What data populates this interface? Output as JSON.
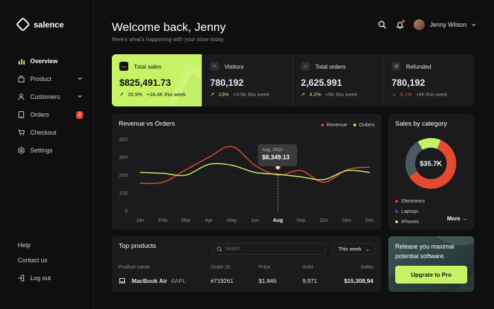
{
  "brand": {
    "name": "salence"
  },
  "nav": {
    "items": [
      {
        "label": "Overview",
        "icon": "bar-chart-icon"
      },
      {
        "label": "Product",
        "icon": "bag-icon"
      },
      {
        "label": "Customers",
        "icon": "user-icon"
      },
      {
        "label": "Orders",
        "icon": "tablet-icon",
        "badge": "2"
      },
      {
        "label": "Checkout",
        "icon": "cart-icon"
      },
      {
        "label": "Settings",
        "icon": "gear-icon"
      }
    ],
    "bottom": [
      {
        "label": "Help"
      },
      {
        "label": "Contact us"
      },
      {
        "label": "Log out",
        "icon": "logout-icon"
      }
    ]
  },
  "header": {
    "title": "Welcome back, Jenny",
    "subtitle": "Here's what's happening with your store today.",
    "user": "Jenny Wilson"
  },
  "stats": [
    {
      "label": "Total sales",
      "value": "$825,491.73",
      "pct": "20.9%",
      "note": "+18.4K this week",
      "dir": "up",
      "icon": "wallet-icon"
    },
    {
      "label": "Visitors",
      "value": "780,192",
      "pct": "13%",
      "note": "+3.5K this week",
      "dir": "up",
      "icon": "users-icon"
    },
    {
      "label": "Total orders",
      "value": "2,625.991",
      "pct": "4.2%",
      "note": "+5K this week",
      "dir": "up",
      "icon": "star-icon"
    },
    {
      "label": "Refunded",
      "value": "780,192",
      "pct": "9.1%",
      "note": "+66 this week",
      "dir": "down",
      "icon": "refund-icon"
    }
  ],
  "revenue": {
    "title": "Revenue vs Orders",
    "legend": {
      "revenue": "Revenue",
      "orders": "Orders"
    },
    "tooltip": {
      "date": "Aug, 2022",
      "value": "$8,349.13"
    }
  },
  "category": {
    "title": "Sales by category",
    "total": "$35.7K",
    "items": [
      "Electronics",
      "Laptops",
      "iPhones"
    ],
    "more": "More"
  },
  "products": {
    "title": "Top products",
    "search_placeholder": "Search",
    "period": "This week",
    "columns": [
      "Product name",
      "Order ID",
      "Price",
      "Sold",
      "Sales"
    ],
    "rows": [
      {
        "name": "MacBook Air",
        "ticker": "AAPL",
        "order_id": "#719261",
        "price": "$1,846",
        "sold": "9,971",
        "sales": "$15,308,94"
      }
    ]
  },
  "upgrade": {
    "text": "Release you maximal potential software.",
    "button": "Upgrate to Pro"
  },
  "colors": {
    "accent": "#c6f266",
    "revenue": "#e24b2f",
    "orders": "#c6f266",
    "laptops": "#4b5a5e"
  },
  "chart_data": [
    {
      "type": "line",
      "title": "Revenue vs Orders",
      "categories": [
        "Jan",
        "Feb",
        "Mar",
        "Apr",
        "May",
        "Jun",
        "Aug",
        "Sep",
        "Oct",
        "Nov",
        "Dec"
      ],
      "y_ticks": [
        0,
        100,
        200,
        300,
        400
      ],
      "ylim": [
        0,
        400
      ],
      "grid": true,
      "legend_position": "top-right",
      "series": [
        {
          "name": "Revenue",
          "values": [
            155,
            160,
            230,
            300,
            360,
            255,
            200,
            225,
            160,
            230,
            245
          ]
        },
        {
          "name": "Orders",
          "values": [
            215,
            210,
            200,
            260,
            255,
            215,
            205,
            190,
            175,
            225,
            215
          ]
        }
      ]
    },
    {
      "type": "pie",
      "title": "Sales by category",
      "categories": [
        "Electronics",
        "Laptops",
        "iPhones"
      ],
      "values": [
        60,
        25,
        15
      ]
    }
  ]
}
